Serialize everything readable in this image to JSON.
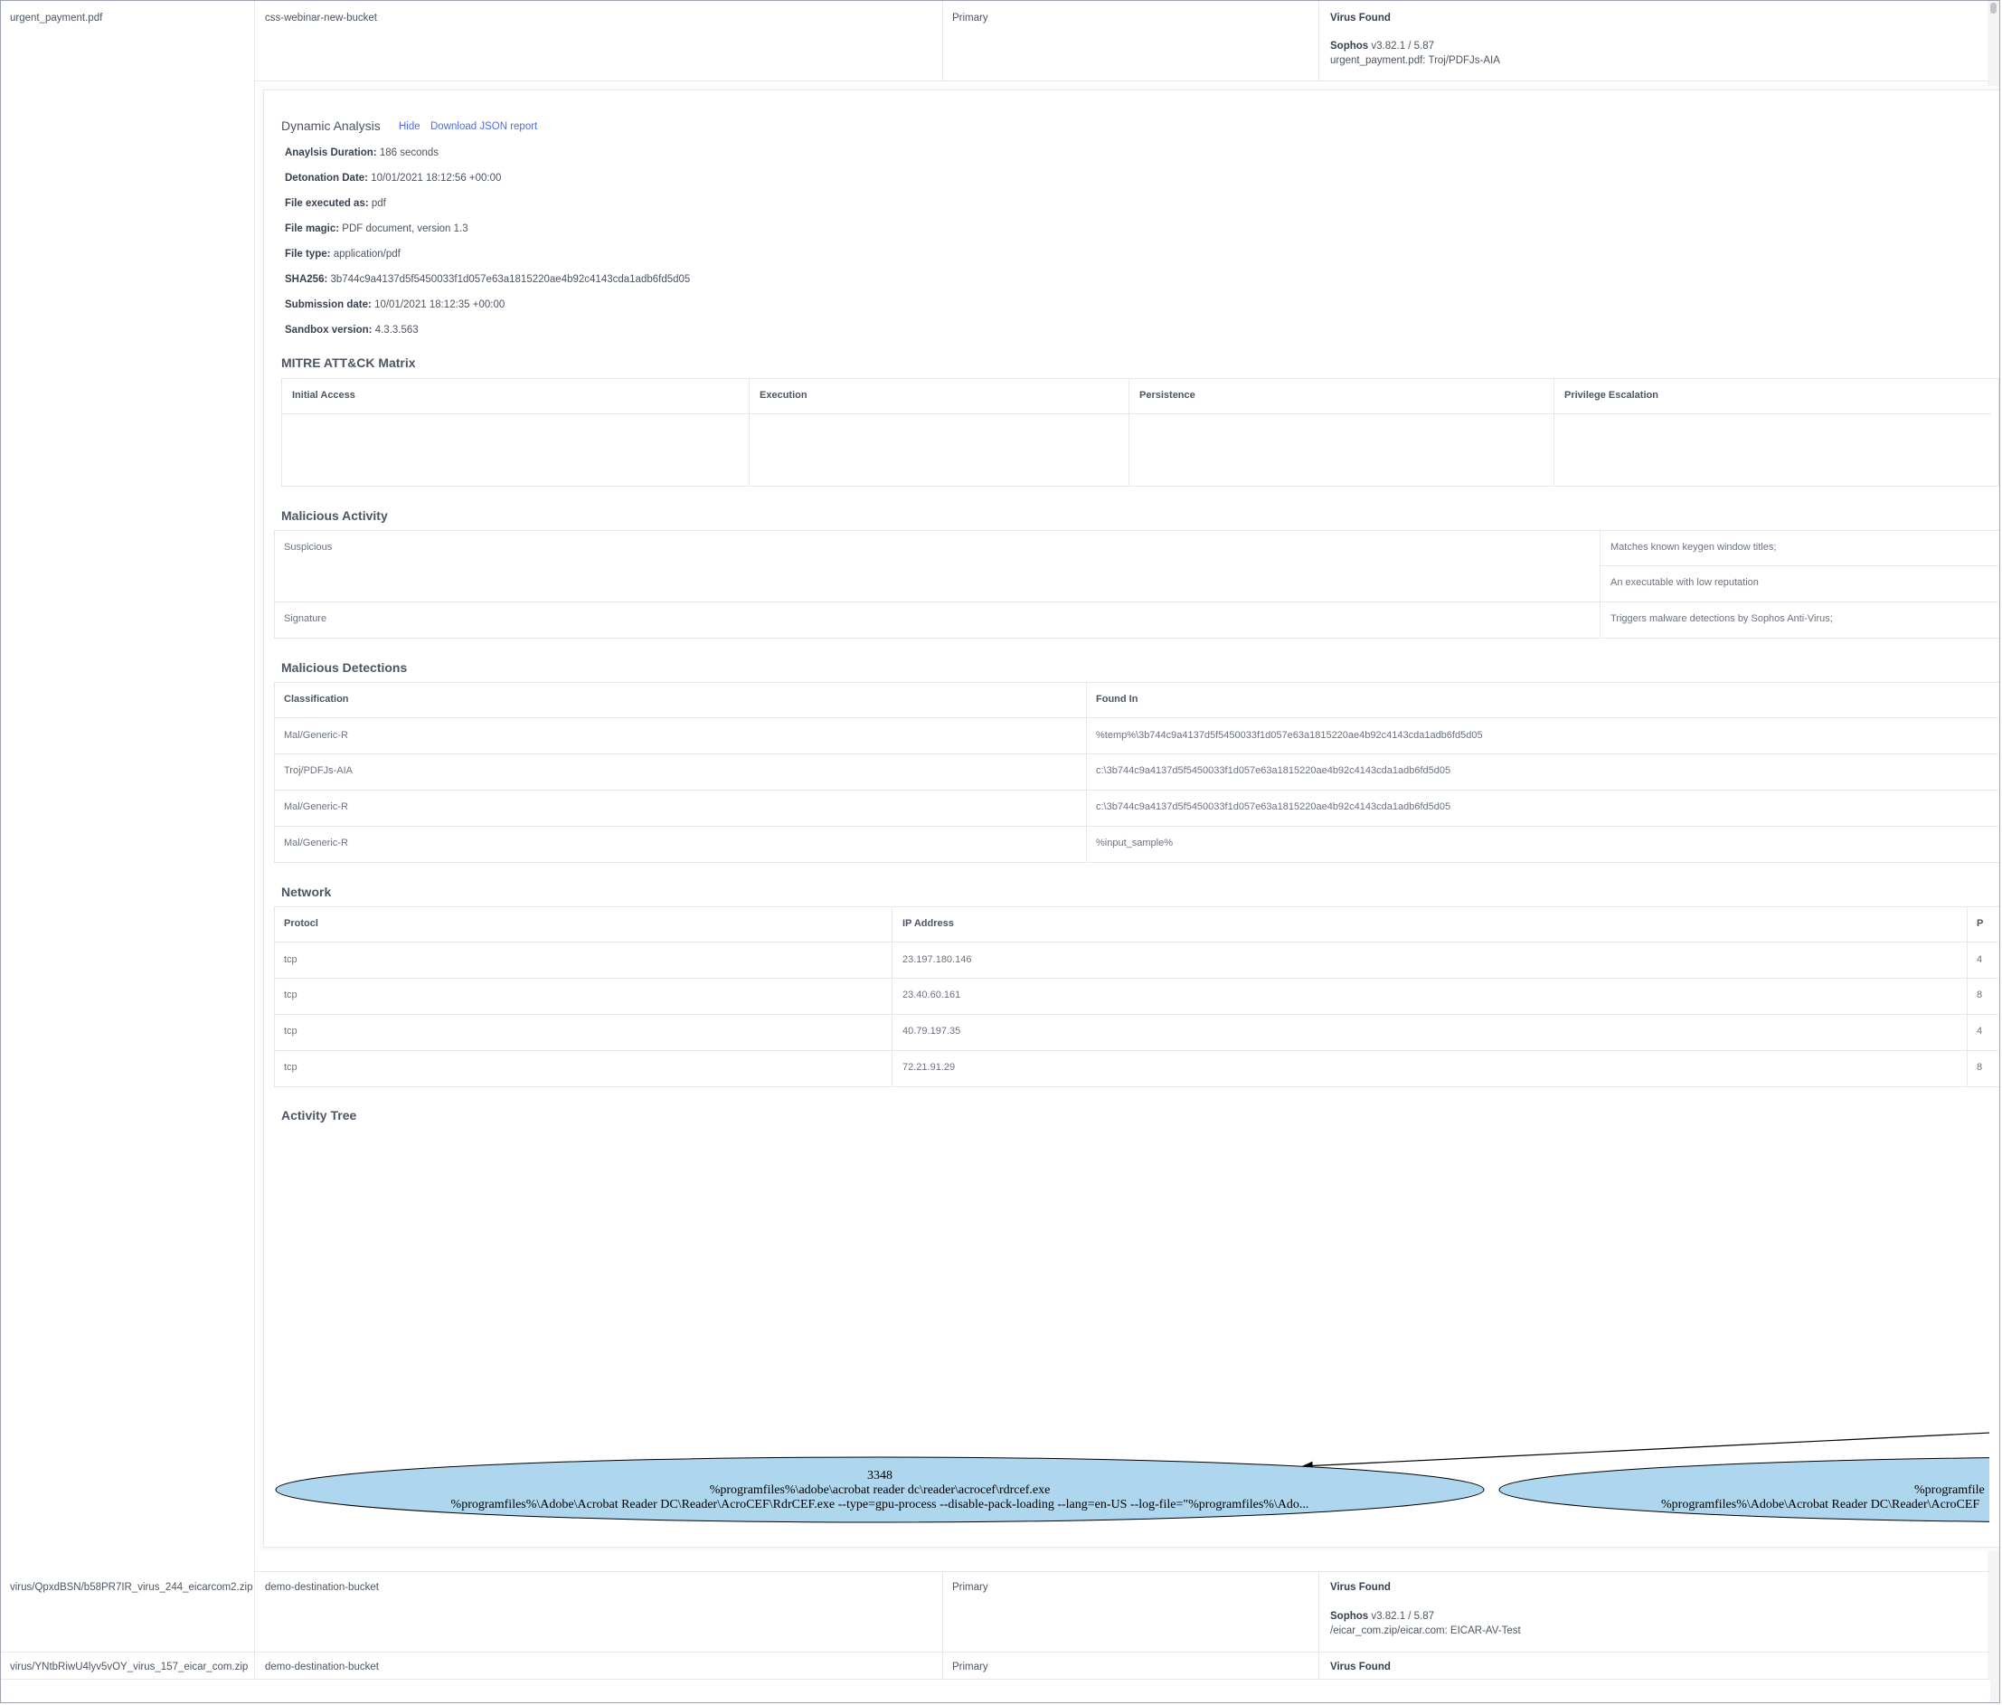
{
  "rows": [
    {
      "file": "urgent_payment.pdf",
      "bucket": "css-webinar-new-bucket",
      "type": "Primary",
      "status": "Virus Found",
      "engine": "Sophos",
      "version": "v3.82.1 / 5.87",
      "detail": "urgent_payment.pdf: Troj/PDFJs-AIA"
    },
    {
      "file": "virus/QpxdBSN/b58PR7IR_virus_244_eicarcom2.zip",
      "bucket": "demo-destination-bucket",
      "type": "Primary",
      "status": "Virus Found",
      "engine": "Sophos",
      "version": "v3.82.1 / 5.87",
      "detail": "/eicar_com.zip/eicar.com: EICAR-AV-Test"
    },
    {
      "file": "virus/YNtbRiwU4lyv5vOY_virus_157_eicar_com.zip",
      "bucket": "demo-destination-bucket",
      "type": "Primary",
      "status": "Virus Found"
    }
  ],
  "dynamic": {
    "title": "Dynamic Analysis",
    "hide_label": "Hide",
    "download_label": "Download JSON report",
    "fields": [
      {
        "label": "Anaylsis Duration:",
        "value": "186 seconds"
      },
      {
        "label": "Detonation Date:",
        "value": "10/01/2021 18:12:56 +00:00"
      },
      {
        "label": "File executed as:",
        "value": "pdf"
      },
      {
        "label": "File magic:",
        "value": "PDF document, version 1.3"
      },
      {
        "label": "File type:",
        "value": "application/pdf"
      },
      {
        "label": "SHA256:",
        "value": "3b744c9a4137d5f5450033f1d057e63a1815220ae4b92c4143cda1adb6fd5d05"
      },
      {
        "label": "Submission date:",
        "value": "10/01/2021 18:12:35 +00:00"
      },
      {
        "label": "Sandbox version:",
        "value": "4.3.3.563"
      }
    ]
  },
  "mitre": {
    "title": "MITRE ATT&CK Matrix",
    "columns": [
      "Initial Access",
      "Execution",
      "Persistence",
      "Privilege Escalation"
    ]
  },
  "malicious_activity": {
    "title": "Malicious Activity",
    "rows": [
      {
        "category": "Suspicious",
        "items": [
          "Matches known keygen window titles;",
          "An executable with low reputation"
        ]
      },
      {
        "category": "Signature",
        "items": [
          "Triggers malware detections by Sophos Anti-Virus;"
        ]
      }
    ]
  },
  "detections": {
    "title": "Malicious Detections",
    "headers": [
      "Classification",
      "Found In"
    ],
    "rows": [
      [
        "Mal/Generic-R",
        "%temp%\\3b744c9a4137d5f5450033f1d057e63a1815220ae4b92c4143cda1adb6fd5d05"
      ],
      [
        "Troj/PDFJs-AIA",
        "c:\\3b744c9a4137d5f5450033f1d057e63a1815220ae4b92c4143cda1adb6fd5d05"
      ],
      [
        "Mal/Generic-R",
        "c:\\3b744c9a4137d5f5450033f1d057e63a1815220ae4b92c4143cda1adb6fd5d05"
      ],
      [
        "Mal/Generic-R",
        "%input_sample%"
      ]
    ]
  },
  "network": {
    "title": "Network",
    "headers": [
      "Protocl",
      "IP Address",
      "P"
    ],
    "rows": [
      [
        "tcp",
        "23.197.180.146",
        "4"
      ],
      [
        "tcp",
        "23.40.60.161",
        "8"
      ],
      [
        "tcp",
        "40.79.197.35",
        "4"
      ],
      [
        "tcp",
        "72.21.91.29",
        "8"
      ]
    ]
  },
  "activity_tree": {
    "title": "Activity Tree",
    "node1": {
      "pid": "3348",
      "path": "%programfiles%\\adobe\\acrobat reader dc\\reader\\acrocef\\rdrcef.exe",
      "cmd": "%programfiles%\\Adobe\\Acrobat Reader DC\\Reader\\AcroCEF\\RdrCEF.exe --type=gpu-process --disable-pack-loading --lang=en-US --log-file=\"%programfiles%\\Ado..."
    },
    "node2": {
      "path": "%programfile",
      "cmd": "%programfiles%\\Adobe\\Acrobat Reader DC\\Reader\\AcroCEF"
    },
    "fill": "#aed6ef"
  }
}
